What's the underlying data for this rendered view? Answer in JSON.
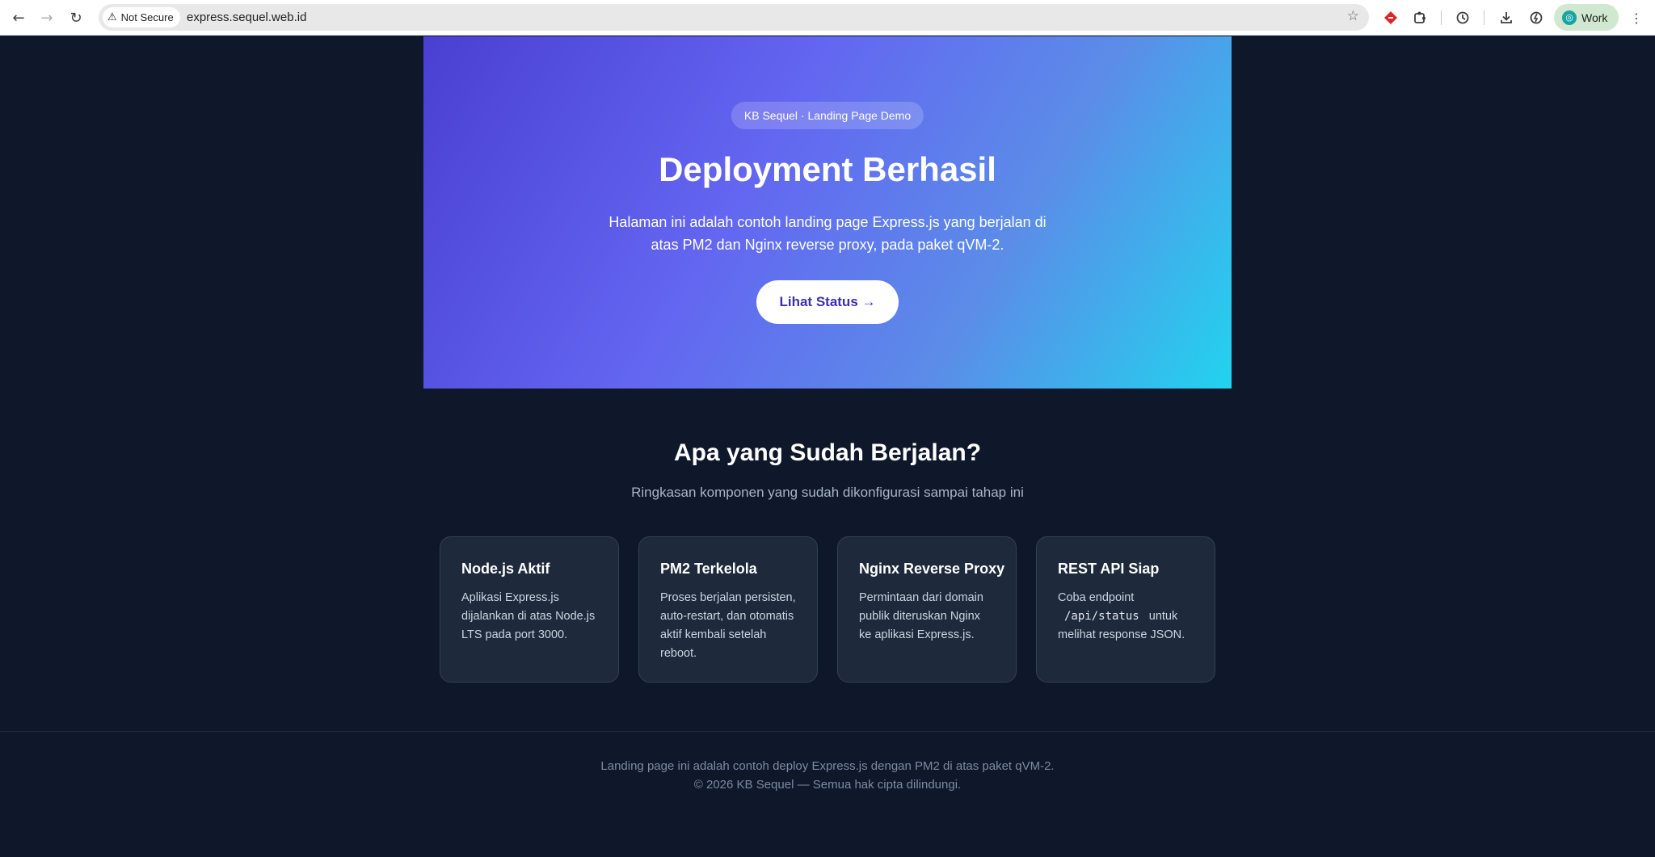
{
  "browser": {
    "security_label": "Not Secure",
    "url": "express.sequel.web.id",
    "profile_label": "Work",
    "icons": {
      "back": "back-arrow-icon",
      "forward": "forward-arrow-icon",
      "reload": "reload-icon",
      "warning": "warning-triangle-icon",
      "bookmark": "star-icon",
      "extension_red": "red-diamond-extension-icon",
      "extensions": "puzzle-icon",
      "history": "history-icon",
      "downloads": "download-icon",
      "performance": "performance-icon",
      "menu": "kebab-menu-icon"
    }
  },
  "hero": {
    "badge": "KB Sequel · Landing Page Demo",
    "title": "Deployment Berhasil",
    "description": "Halaman ini adalah contoh landing page Express.js yang berjalan di atas PM2 dan Nginx reverse proxy, pada paket qVM-2.",
    "cta_label": "Lihat Status →",
    "colors": {
      "gradient_start": "#4a3fd2",
      "gradient_mid": "#6366f1",
      "gradient_end": "#22d3ee",
      "cta_text": "#3b2fb0"
    }
  },
  "section": {
    "title": "Apa yang Sudah Berjalan?",
    "subtitle": "Ringkasan komponen yang sudah dikonfigurasi sampai tahap ini"
  },
  "cards": [
    {
      "title": "Node.js Aktif",
      "text": "Aplikasi Express.js dijalankan di atas Node.js LTS pada port 3000."
    },
    {
      "title": "PM2 Terkelola",
      "text": "Proses berjalan persisten, auto-restart, dan otomatis aktif kembali setelah reboot."
    },
    {
      "title": "Nginx Reverse Proxy",
      "text": "Permintaan dari domain publik diteruskan Nginx ke aplikasi Express.js."
    },
    {
      "title": "REST API Siap",
      "text_before": "Coba endpoint",
      "code": "/api/status",
      "text_after": "untuk melihat response JSON."
    }
  ],
  "footer": {
    "line1": "Landing page ini adalah contoh deploy Express.js dengan PM2 di atas paket qVM-2.",
    "line2": "© 2026 KB Sequel — Semua hak cipta dilindungi."
  },
  "theme": {
    "background": "#0f172a",
    "card_bg": "#1e293b",
    "card_border": "#334155"
  }
}
